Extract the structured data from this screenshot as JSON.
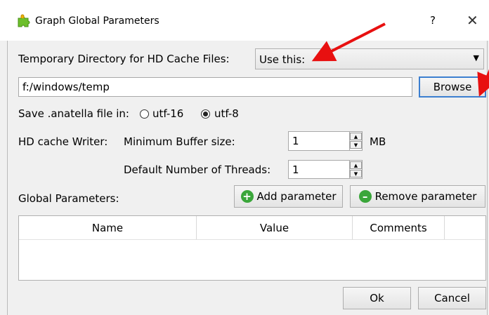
{
  "window": {
    "title": "Graph Global Parameters",
    "help_glyph": "?",
    "close_glyph": "✕"
  },
  "temp_dir": {
    "label": "Temporary Directory for HD Cache Files:",
    "combo_value": "Use this:",
    "path_value": "f:/windows/temp",
    "browse_label": "Browse"
  },
  "save": {
    "label": "Save .anatella file in:",
    "options": [
      {
        "label": "utf-16",
        "checked": false
      },
      {
        "label": "utf-8",
        "checked": true
      }
    ]
  },
  "cache_writer": {
    "label": "HD cache Writer:",
    "buffer_label": "Minimum Buffer size:",
    "buffer_value": "1",
    "buffer_unit": "MB",
    "threads_label": "Default Number of Threads:",
    "threads_value": "1"
  },
  "global_params": {
    "label": "Global Parameters:",
    "add_label": "Add parameter",
    "remove_label": "Remove parameter",
    "columns": [
      "Name",
      "Value",
      "Comments"
    ]
  },
  "footer": {
    "ok_label": "Ok",
    "cancel_label": "Cancel"
  },
  "colors": {
    "accent_focus": "#3c7fd0",
    "annotation_arrow": "#e81010",
    "add_icon": "#3aa63a",
    "remove_icon": "#3aa63a"
  }
}
